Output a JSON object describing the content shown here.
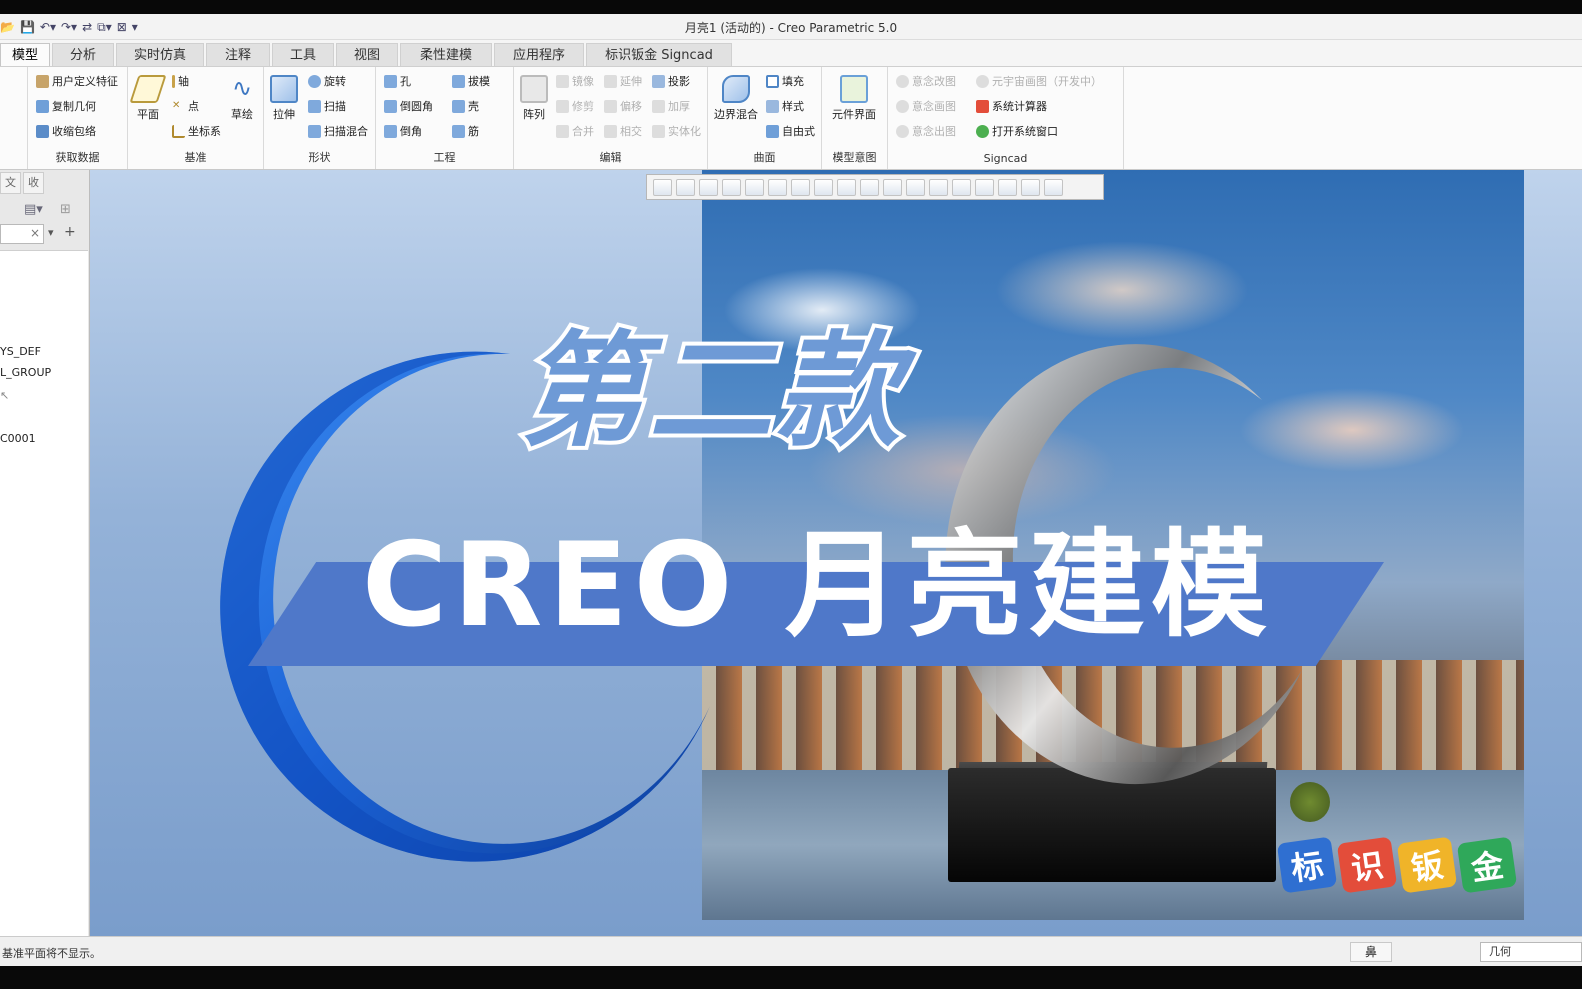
{
  "window": {
    "title": "月亮1 (活动的) - Creo Parametric 5.0"
  },
  "tabs": [
    "模型",
    "分析",
    "实时仿真",
    "注释",
    "工具",
    "视图",
    "柔性建模",
    "应用程序",
    "标识钣金 Signcad"
  ],
  "ribbon": {
    "groups": {
      "get_data": {
        "label": "获取数据",
        "items": [
          "用户定义特征",
          "复制几何",
          "收缩包络"
        ]
      },
      "datum": {
        "label": "基准",
        "big": "平面",
        "items": [
          "轴",
          "点",
          "坐标系"
        ],
        "extra": "草绘"
      },
      "shapes": {
        "label": "形状",
        "big": "拉伸",
        "items": [
          "旋转",
          "扫描",
          "扫描混合"
        ]
      },
      "engineering": {
        "label": "工程",
        "items": [
          "孔",
          "倒圆角",
          "倒角",
          "拔模",
          "壳",
          "筋"
        ]
      },
      "editing": {
        "label": "编辑",
        "big": "阵列",
        "items": [
          "镜像",
          "修剪",
          "合并",
          "延伸",
          "偏移",
          "相交",
          "投影",
          "加厚",
          "实体化"
        ]
      },
      "surfaces": {
        "label": "曲面",
        "big": "边界混合",
        "items": [
          "填充",
          "样式",
          "自由式"
        ]
      },
      "model_intent": {
        "label": "模型意图",
        "big": "元件界面"
      },
      "signcad": {
        "label": "Signcad",
        "items": [
          "意念改图",
          "意念画图",
          "意念出图",
          "元宇宙画图（开发中）",
          "系统计算器",
          "打开系统窗口"
        ]
      }
    }
  },
  "left_panel": {
    "tabs": [
      "文",
      "收"
    ],
    "tree": [
      "YS_DEF",
      "L_GROUP",
      "C0001"
    ]
  },
  "overlay": {
    "headline": "第二款",
    "title": "CREO 月亮建模",
    "badges": [
      "标",
      "识",
      "钣",
      "金"
    ]
  },
  "status": {
    "message": "基准平面将不显示。",
    "selection_filter": "几何",
    "sel_icon": "鼻"
  },
  "colors": {
    "accent": "#4f78c9",
    "moon_blue": "#1b62d6",
    "headline_fill": "#6e9ad6",
    "badge_colors": [
      "#2f6fd1",
      "#e34d3a",
      "#f0b429",
      "#2fa85a"
    ]
  }
}
